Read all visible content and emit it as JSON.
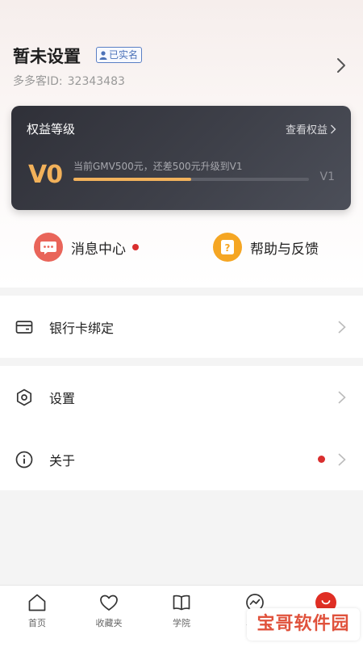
{
  "profile": {
    "name": "暂未设置",
    "verified_badge": "已实名",
    "id_label": "多多客ID:",
    "id_value": "32343483"
  },
  "rights_card": {
    "title": "权益等级",
    "view_link": "查看权益",
    "current_level": "V0",
    "progress_text": "当前GMV500元，还差500元升级到V1",
    "next_level": "V1",
    "progress_fraction": 0.5
  },
  "quick_actions": [
    {
      "label": "消息中心",
      "icon": "message-icon",
      "has_dot": true
    },
    {
      "label": "帮助与反馈",
      "icon": "help-icon",
      "has_dot": false
    }
  ],
  "menu": {
    "bank_card": {
      "label": "银行卡绑定",
      "icon": "card-icon"
    },
    "settings": {
      "label": "设置",
      "icon": "settings-hexagon-icon"
    },
    "about": {
      "label": "关于",
      "icon": "info-icon",
      "has_dot": true
    }
  },
  "tabbar": {
    "items": [
      {
        "label": "首页",
        "icon": "home-icon"
      },
      {
        "label": "收藏夹",
        "icon": "heart-icon"
      },
      {
        "label": "学院",
        "icon": "book-icon"
      },
      {
        "label": "收益",
        "icon": "chart-circle-icon"
      },
      {
        "label": "我的",
        "icon": "me-icon",
        "active": true
      }
    ]
  },
  "watermark": "宝哥软件园",
  "colors": {
    "accent_red": "#e02e24",
    "gold": "#f2b15a",
    "card_bg": "#3e4049",
    "message_icon_bg": "#e9655a",
    "help_icon_bg": "#f5a623"
  }
}
